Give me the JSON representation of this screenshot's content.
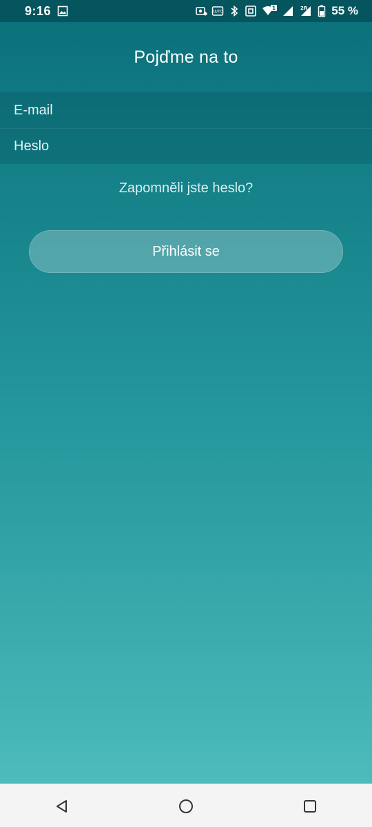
{
  "status_bar": {
    "time": "9:16",
    "battery_percent": "55 %",
    "sim1_badge": "1",
    "sim2_badge": "2R",
    "icons": [
      "image-icon",
      "screen-record-icon",
      "auto-brightness-icon",
      "bluetooth-icon",
      "nfc-icon",
      "wifi-icon",
      "signal-icon",
      "signal-icon",
      "battery-icon"
    ]
  },
  "header": {
    "title": "Pojďme na to"
  },
  "form": {
    "email_placeholder": "E-mail",
    "email_value": "",
    "password_placeholder": "Heslo",
    "password_value": ""
  },
  "forgot_password_label": "Zapomněli jste heslo?",
  "login_button_label": "Přihlásit se",
  "nav_bar": {
    "icons": [
      "back-icon",
      "home-icon",
      "recents-icon"
    ]
  },
  "colors": {
    "status_bar": "#05555e",
    "gradient_top": "#0a6f7a",
    "gradient_bottom": "#52c0bf",
    "nav_bar": "#f4f4f4"
  }
}
